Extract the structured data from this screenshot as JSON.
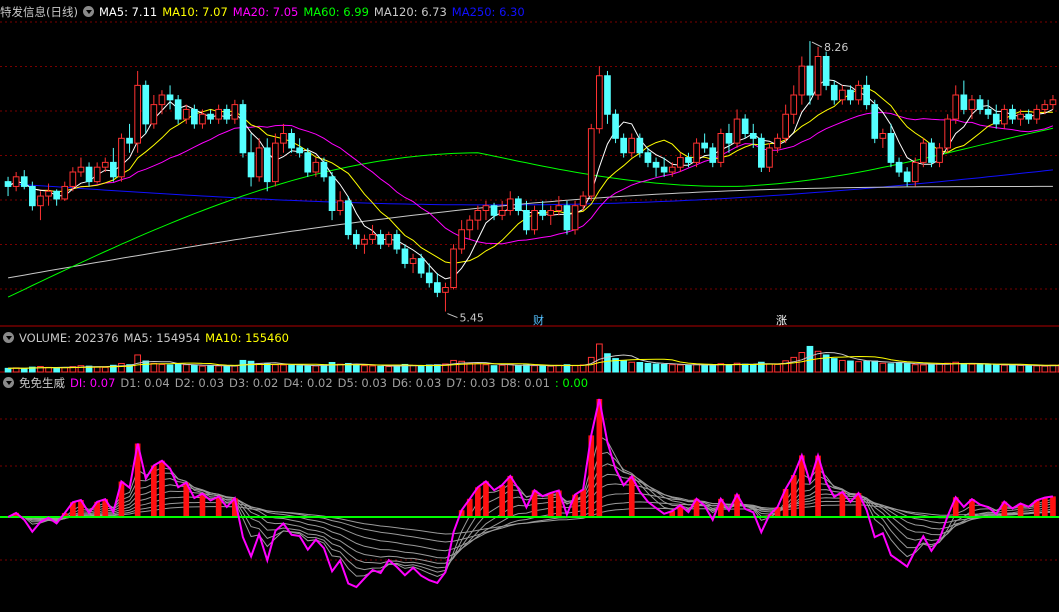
{
  "price_panel": {
    "stock_name": "特发信息(日线)",
    "indicators": [
      {
        "label": "MA5: 7.11",
        "color": "#ffffff"
      },
      {
        "label": "MA10: 7.07",
        "color": "#ffff00"
      },
      {
        "label": "MA20: 7.05",
        "color": "#ff00ff"
      },
      {
        "label": "MA60: 6.99",
        "color": "#00ff00"
      },
      {
        "label": "MA120: 6.73",
        "color": "#c8c8c8"
      },
      {
        "label": "MA250: 6.30",
        "color": "#1010ff"
      }
    ],
    "high_label": "8.26",
    "low_label": "5.45",
    "markers": [
      "财",
      "涨"
    ]
  },
  "volume_panel": {
    "indicators": [
      {
        "label": "VOLUME: 202376",
        "color": "#c8c8c8"
      },
      {
        "label": "MA5: 154954",
        "color": "#c8c8c8"
      },
      {
        "label": "MA10: 155460",
        "color": "#ffff00"
      }
    ]
  },
  "indicator_panel": {
    "name": "免免生威",
    "indicators": [
      {
        "label": "DI: 0.07",
        "color": "#ff00ff"
      },
      {
        "label": "D1: 0.04",
        "color": "#a0a0a0"
      },
      {
        "label": "D2: 0.03",
        "color": "#a0a0a0"
      },
      {
        "label": "D3: 0.02",
        "color": "#a0a0a0"
      },
      {
        "label": "D4: 0.02",
        "color": "#a0a0a0"
      },
      {
        "label": "D5: 0.03",
        "color": "#a0a0a0"
      },
      {
        "label": "D6: 0.03",
        "color": "#a0a0a0"
      },
      {
        "label": "D7: 0.03",
        "color": "#a0a0a0"
      },
      {
        "label": "D8: 0.01",
        "color": "#a0a0a0"
      },
      {
        "label": ": 0.00",
        "color": "#00ff00"
      }
    ]
  },
  "colors": {
    "up": "#ff3232",
    "down": "#54ffff",
    "grid": "#7a0000",
    "divider": "#b00000"
  },
  "chart_data": {
    "type": "candlestick",
    "price_range": [
      5.3,
      8.5
    ],
    "grid": true,
    "candles": [
      [
        6.8,
        6.85,
        6.65,
        6.75
      ],
      [
        6.75,
        6.9,
        6.7,
        6.85
      ],
      [
        6.85,
        6.92,
        6.72,
        6.75
      ],
      [
        6.75,
        6.8,
        6.5,
        6.55
      ],
      [
        6.55,
        6.7,
        6.4,
        6.65
      ],
      [
        6.65,
        6.78,
        6.55,
        6.7
      ],
      [
        6.7,
        6.72,
        6.55,
        6.62
      ],
      [
        6.62,
        6.8,
        6.6,
        6.75
      ],
      [
        6.75,
        6.95,
        6.7,
        6.9
      ],
      [
        6.9,
        7.05,
        6.85,
        6.95
      ],
      [
        6.95,
        7.0,
        6.75,
        6.8
      ],
      [
        6.8,
        7.0,
        6.78,
        6.95
      ],
      [
        6.95,
        7.05,
        6.9,
        7.0
      ],
      [
        7.0,
        7.15,
        6.8,
        6.85
      ],
      [
        6.85,
        7.3,
        6.8,
        7.25
      ],
      [
        7.25,
        7.4,
        7.1,
        7.2
      ],
      [
        7.2,
        7.95,
        7.1,
        7.8
      ],
      [
        7.8,
        7.85,
        7.3,
        7.4
      ],
      [
        7.4,
        7.7,
        7.35,
        7.6
      ],
      [
        7.6,
        7.75,
        7.5,
        7.7
      ],
      [
        7.7,
        7.8,
        7.55,
        7.65
      ],
      [
        7.65,
        7.7,
        7.4,
        7.45
      ],
      [
        7.45,
        7.6,
        7.4,
        7.55
      ],
      [
        7.55,
        7.6,
        7.35,
        7.4
      ],
      [
        7.4,
        7.55,
        7.35,
        7.5
      ],
      [
        7.5,
        7.55,
        7.4,
        7.45
      ],
      [
        7.45,
        7.6,
        7.4,
        7.55
      ],
      [
        7.55,
        7.6,
        7.4,
        7.45
      ],
      [
        7.45,
        7.65,
        7.4,
        7.6
      ],
      [
        7.6,
        7.65,
        7.05,
        7.1
      ],
      [
        7.1,
        7.3,
        6.75,
        6.85
      ],
      [
        6.85,
        7.25,
        6.8,
        7.15
      ],
      [
        7.15,
        7.25,
        6.7,
        6.8
      ],
      [
        6.8,
        7.3,
        6.75,
        7.2
      ],
      [
        7.2,
        7.4,
        7.1,
        7.3
      ],
      [
        7.3,
        7.35,
        7.1,
        7.15
      ],
      [
        7.15,
        7.25,
        7.05,
        7.1
      ],
      [
        7.1,
        7.15,
        6.85,
        6.9
      ],
      [
        6.9,
        7.05,
        6.85,
        7.0
      ],
      [
        7.0,
        7.05,
        6.8,
        6.85
      ],
      [
        6.85,
        6.9,
        6.4,
        6.5
      ],
      [
        6.5,
        6.7,
        6.45,
        6.6
      ],
      [
        6.6,
        6.65,
        6.2,
        6.25
      ],
      [
        6.25,
        6.3,
        6.1,
        6.15
      ],
      [
        6.15,
        6.25,
        6.05,
        6.2
      ],
      [
        6.2,
        6.35,
        6.15,
        6.25
      ],
      [
        6.25,
        6.3,
        6.1,
        6.15
      ],
      [
        6.15,
        6.28,
        6.12,
        6.25
      ],
      [
        6.25,
        6.3,
        6.05,
        6.1
      ],
      [
        6.1,
        6.15,
        5.9,
        5.95
      ],
      [
        5.95,
        6.05,
        5.85,
        6.0
      ],
      [
        6.0,
        6.05,
        5.8,
        5.85
      ],
      [
        5.85,
        5.95,
        5.7,
        5.75
      ],
      [
        5.75,
        5.85,
        5.6,
        5.65
      ],
      [
        5.65,
        5.75,
        5.45,
        5.7
      ],
      [
        5.7,
        6.15,
        5.68,
        6.1
      ],
      [
        6.1,
        6.4,
        6.05,
        6.3
      ],
      [
        6.3,
        6.45,
        6.2,
        6.4
      ],
      [
        6.4,
        6.55,
        6.3,
        6.5
      ],
      [
        6.5,
        6.6,
        6.4,
        6.55
      ],
      [
        6.55,
        6.58,
        6.4,
        6.45
      ],
      [
        6.45,
        6.6,
        6.4,
        6.5
      ],
      [
        6.5,
        6.7,
        6.45,
        6.62
      ],
      [
        6.62,
        6.65,
        6.45,
        6.5
      ],
      [
        6.5,
        6.6,
        6.25,
        6.3
      ],
      [
        6.3,
        6.55,
        6.25,
        6.5
      ],
      [
        6.5,
        6.6,
        6.4,
        6.45
      ],
      [
        6.45,
        6.55,
        6.35,
        6.5
      ],
      [
        6.5,
        6.65,
        6.45,
        6.55
      ],
      [
        6.55,
        6.6,
        6.25,
        6.3
      ],
      [
        6.3,
        6.6,
        6.25,
        6.55
      ],
      [
        6.55,
        6.7,
        6.5,
        6.65
      ],
      [
        6.65,
        7.4,
        6.6,
        7.35
      ],
      [
        7.35,
        8.0,
        7.3,
        7.9
      ],
      [
        7.9,
        7.95,
        7.4,
        7.5
      ],
      [
        7.5,
        7.55,
        7.2,
        7.25
      ],
      [
        7.25,
        7.3,
        7.05,
        7.1
      ],
      [
        7.1,
        7.3,
        7.05,
        7.25
      ],
      [
        7.25,
        7.3,
        7.05,
        7.1
      ],
      [
        7.1,
        7.15,
        6.95,
        7.0
      ],
      [
        7.0,
        7.05,
        6.85,
        6.95
      ],
      [
        6.95,
        7.05,
        6.85,
        6.9
      ],
      [
        6.9,
        7.0,
        6.85,
        6.95
      ],
      [
        6.95,
        7.1,
        6.9,
        7.05
      ],
      [
        7.05,
        7.1,
        6.95,
        7.0
      ],
      [
        7.0,
        7.25,
        6.95,
        7.2
      ],
      [
        7.2,
        7.3,
        7.1,
        7.15
      ],
      [
        7.15,
        7.2,
        6.95,
        7.0
      ],
      [
        7.0,
        7.35,
        6.95,
        7.3
      ],
      [
        7.3,
        7.4,
        7.1,
        7.2
      ],
      [
        7.2,
        7.55,
        7.15,
        7.45
      ],
      [
        7.45,
        7.5,
        7.25,
        7.3
      ],
      [
        7.3,
        7.4,
        7.15,
        7.25
      ],
      [
        7.25,
        7.3,
        6.9,
        6.95
      ],
      [
        6.95,
        7.2,
        6.9,
        7.15
      ],
      [
        7.15,
        7.3,
        7.1,
        7.25
      ],
      [
        7.25,
        7.6,
        7.2,
        7.5
      ],
      [
        7.5,
        7.8,
        7.4,
        7.7
      ],
      [
        7.7,
        8.1,
        7.6,
        8.0
      ],
      [
        8.0,
        8.26,
        7.6,
        7.7
      ],
      [
        7.7,
        8.2,
        7.65,
        8.1
      ],
      [
        8.1,
        8.15,
        7.75,
        7.8
      ],
      [
        7.8,
        7.85,
        7.6,
        7.65
      ],
      [
        7.65,
        7.8,
        7.6,
        7.75
      ],
      [
        7.75,
        7.8,
        7.6,
        7.65
      ],
      [
        7.65,
        7.85,
        7.6,
        7.8
      ],
      [
        7.8,
        7.9,
        7.55,
        7.6
      ],
      [
        7.6,
        7.65,
        7.2,
        7.25
      ],
      [
        7.25,
        7.35,
        7.15,
        7.3
      ],
      [
        7.3,
        7.4,
        6.95,
        7.0
      ],
      [
        7.0,
        7.05,
        6.85,
        6.9
      ],
      [
        6.9,
        6.95,
        6.75,
        6.8
      ],
      [
        6.8,
        7.05,
        6.75,
        7.0
      ],
      [
        7.0,
        7.25,
        6.95,
        7.2
      ],
      [
        7.2,
        7.25,
        6.95,
        7.0
      ],
      [
        7.0,
        7.2,
        6.95,
        7.15
      ],
      [
        7.15,
        7.5,
        7.1,
        7.45
      ],
      [
        7.45,
        7.8,
        7.4,
        7.7
      ],
      [
        7.7,
        7.85,
        7.5,
        7.55
      ],
      [
        7.55,
        7.7,
        7.45,
        7.65
      ],
      [
        7.65,
        7.7,
        7.5,
        7.55
      ],
      [
        7.55,
        7.65,
        7.45,
        7.5
      ],
      [
        7.5,
        7.6,
        7.35,
        7.4
      ],
      [
        7.4,
        7.6,
        7.35,
        7.55
      ],
      [
        7.55,
        7.6,
        7.4,
        7.45
      ],
      [
        7.45,
        7.55,
        7.38,
        7.5
      ],
      [
        7.5,
        7.55,
        7.4,
        7.45
      ],
      [
        7.45,
        7.6,
        7.4,
        7.55
      ],
      [
        7.55,
        7.65,
        7.5,
        7.6
      ],
      [
        7.6,
        7.7,
        7.55,
        7.65
      ]
    ],
    "ma_levels": {
      "MA60_range": [
        6.2,
        7.0
      ],
      "MA250_range": [
        6.4,
        6.9
      ]
    },
    "volume": [
      30,
      34,
      28,
      40,
      45,
      38,
      33,
      36,
      44,
      52,
      48,
      40,
      38,
      55,
      70,
      60,
      140,
      90,
      70,
      62,
      58,
      64,
      60,
      55,
      48,
      52,
      50,
      47,
      49,
      95,
      88,
      70,
      66,
      60,
      58,
      55,
      52,
      49,
      50,
      60,
      78,
      64,
      70,
      58,
      52,
      50,
      47,
      45,
      50,
      62,
      55,
      52,
      58,
      60,
      66,
      95,
      88,
      74,
      68,
      60,
      52,
      56,
      62,
      50,
      58,
      52,
      50,
      48,
      55,
      60,
      52,
      58,
      120,
      230,
      150,
      110,
      90,
      80,
      78,
      70,
      65,
      62,
      60,
      58,
      55,
      62,
      58,
      55,
      68,
      60,
      72,
      64,
      60,
      80,
      66,
      62,
      92,
      120,
      160,
      210,
      170,
      140,
      110,
      95,
      90,
      85,
      88,
      90,
      72,
      68,
      75,
      70,
      60,
      58,
      62,
      66,
      72,
      80,
      70,
      64,
      62,
      60,
      58,
      56,
      55,
      54,
      52,
      50,
      48,
      56,
      58,
      60
    ]
  }
}
